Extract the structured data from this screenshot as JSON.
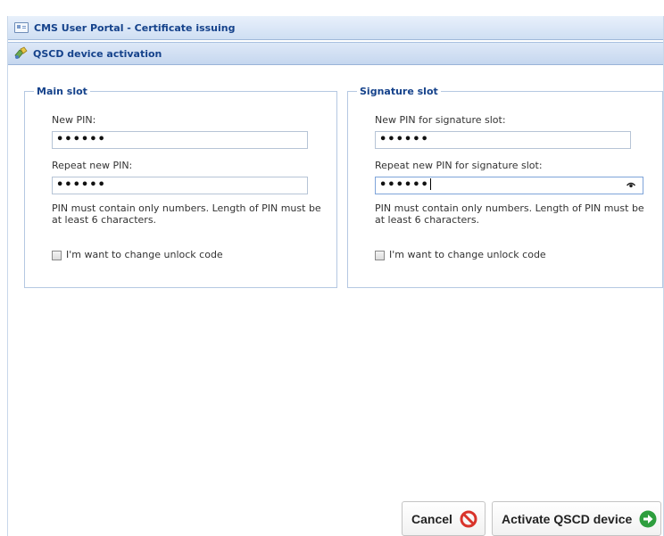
{
  "window": {
    "title": "CMS User Portal - Certificate issuing",
    "panel_title": "QSCD device activation"
  },
  "main_slot": {
    "legend": "Main slot",
    "new_pin_label": "New PIN:",
    "new_pin_value": "••••••",
    "repeat_pin_label": "Repeat new PIN:",
    "repeat_pin_value": "••••••",
    "hint_line1": "PIN must contain only numbers. Length of PIN must be",
    "hint_line2": "at least 6 characters.",
    "unlock_label": "I'm want to change unlock code",
    "unlock_checked": false
  },
  "signature_slot": {
    "legend": "Signature slot",
    "new_pin_label": "New PIN for signature slot:",
    "new_pin_value": "••••••",
    "repeat_pin_label": "Repeat new PIN for signature slot:",
    "repeat_pin_value": "••••••",
    "hint_line1": "PIN must contain only numbers. Length of PIN must be",
    "hint_line2": "at least 6 characters.",
    "unlock_label": "I'm want to change unlock code",
    "unlock_checked": false
  },
  "buttons": {
    "cancel_label": "Cancel",
    "activate_label": "Activate QSCD device"
  },
  "icons": {
    "title": "window-icon",
    "panel": "device-icon",
    "cancel": "cancel-icon",
    "activate": "arrow-right-icon",
    "reveal": "eye-icon"
  },
  "colors": {
    "header_text": "#15428b",
    "cancel_icon": "#d9342b",
    "activate_icon": "#2e9e3e"
  }
}
